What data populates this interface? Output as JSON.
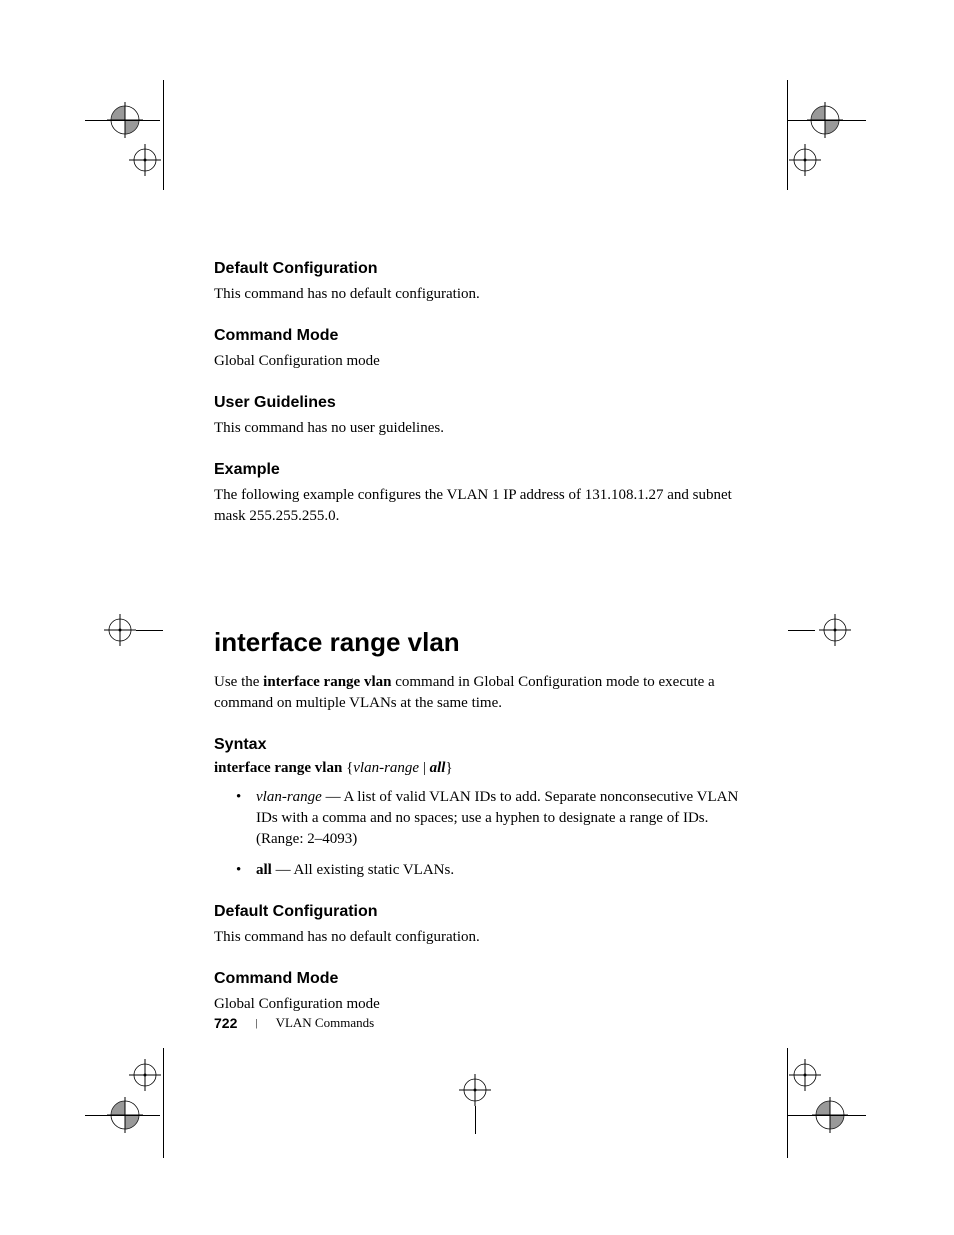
{
  "sections": {
    "default_config_1": {
      "heading": "Default Configuration",
      "body": "This command has no default configuration."
    },
    "command_mode_1": {
      "heading": "Command Mode",
      "body": "Global Configuration mode"
    },
    "user_guidelines": {
      "heading": "User Guidelines",
      "body": "This command has no user guidelines."
    },
    "example": {
      "heading": "Example",
      "body": "The following example configures the VLAN 1 IP address of 131.108.1.27 and subnet mask 255.255.255.0."
    }
  },
  "command": {
    "title": "interface range vlan",
    "intro_pre": "Use the ",
    "intro_bold": "interface range vlan",
    "intro_post": " command in Global Configuration mode to execute a command on multiple VLANs at the same time."
  },
  "syntax": {
    "heading": "Syntax",
    "line_bold": "interface range vlan",
    "line_brace_open": " {",
    "line_param1": "vlan-range",
    "line_pipe": " | ",
    "line_param2": "all",
    "line_brace_close": "}",
    "bullet1": {
      "param": "vlan-range",
      "dash": " — ",
      "desc": "A list of valid VLAN IDs to add. Separate nonconsecutive VLAN IDs with a comma and no spaces; use a hyphen to designate a range of IDs. (Range: 2–4093)"
    },
    "bullet2": {
      "param": "all",
      "dash": " — ",
      "desc": "All existing static VLANs."
    }
  },
  "sections2": {
    "default_config_2": {
      "heading": "Default Configuration",
      "body": "This command has no default configuration."
    },
    "command_mode_2": {
      "heading": "Command Mode",
      "body": "Global Configuration mode"
    }
  },
  "footer": {
    "page": "722",
    "section": "VLAN Commands"
  }
}
